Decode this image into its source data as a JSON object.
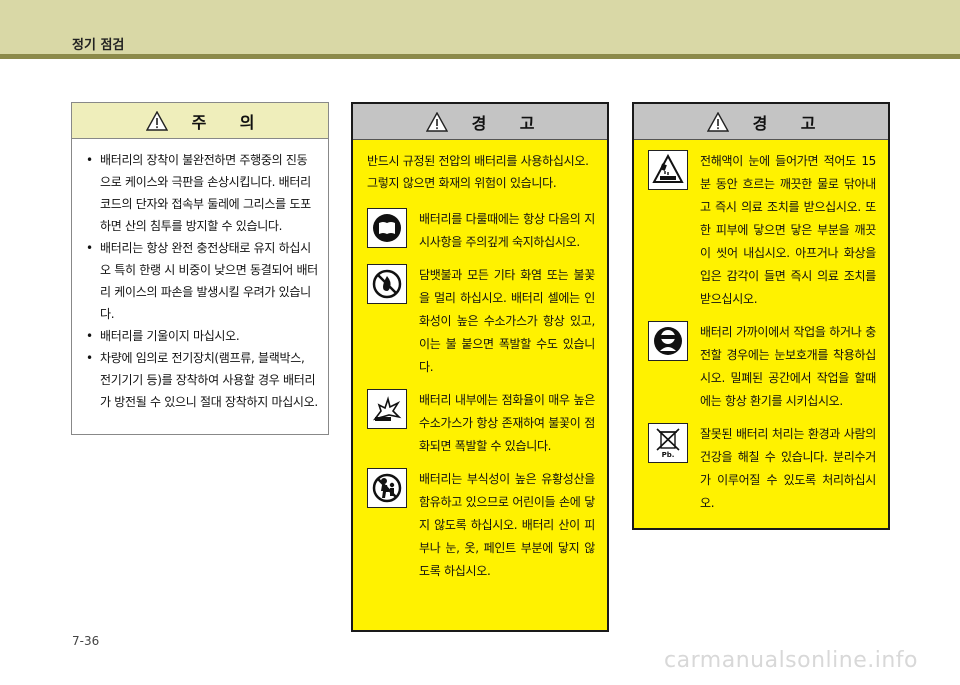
{
  "header": {
    "title": "정기 점검"
  },
  "caution": {
    "heading": "주      의",
    "items": [
      "배터리의 장착이 불완전하면 주행중의 진동으로 케이스와 극판을 손상시킵니다. 배터리 코드의 단자와 접속부 둘레에 그리스를 도포하면 산의 침투를 방지할 수 있습니다.",
      "배터리는 항상 완전 충전상태로 유지 하십시오 특히 한랭 시 비중이 낮으면 동결되어 배터리 케이스의 파손을 발생시킬 우려가 있습니다.",
      "배터리를 기울이지 마십시오.",
      "차량에 임의로 전기장치(램프류, 블랙박스, 전기기기 등)를 장착하여 사용할 경우 배터리가 방전될 수 있으니 절대 장착하지 마십시오."
    ]
  },
  "warning1": {
    "heading": "경      고",
    "intro": "반드시 규정된 전압의 배터리를 사용하십시오. 그렇지 않으면 화재의 위험이 있습니다.",
    "items": [
      {
        "icon": "book-icon",
        "text": "배터리를 다룰때에는 항상 다음의 지시사항을 주의깊게 숙지하십시오."
      },
      {
        "icon": "no-fire-icon",
        "text": "담뱃불과 모든 기타 화염 또는 불꽃을 멀리 하십시오. 배터리 셀에는 인화성이 높은 수소가스가 항상 있고, 이는 불 붙으면 폭발할 수도 있습니다."
      },
      {
        "icon": "explosion-icon",
        "text": "배터리 내부에는 점화율이 매우 높은 수소가스가 항상 존재하여 불꽃이 점화되면 폭발할 수 있습니다."
      },
      {
        "icon": "no-children-icon",
        "text": "배터리는 부식성이 높은 유황성산을 함유하고 있으므로 어린이들 손에 닿지 않도록 하십시오. 배터리 산이 피부나 눈, 옷, 페인트 부분에 닿지 않도록 하십시오."
      }
    ]
  },
  "warning2": {
    "heading": "경      고",
    "items": [
      {
        "icon": "acid-burn-icon",
        "text": "전해액이 눈에 들어가면 적어도 15분 동안 흐르는 깨끗한 물로 닦아내고 즉시 의료 조치를 받으십시오. 또한 피부에 닿으면 닿은 부분을 깨끗이 씻어 내십시오. 아프거나 화상을 입은 감각이 들면 즉시 의료 조치를 받으십시오."
      },
      {
        "icon": "eye-protection-icon",
        "text": "배터리 가까이에서 작업을 하거나 충전할 경우에는 눈보호개를 착용하십시오. 밀폐된 공간에서 작업을 할때에는 항상 환기를 시키십시오."
      },
      {
        "icon": "recycle-bin-icon",
        "text": "잘못된 배터리 처리는 환경과 사람의 건강을 해칠 수 있습니다. 분리수거가 이루어질 수 있도록 처리하십시오.",
        "label": "Pb."
      }
    ]
  },
  "page": {
    "number": "7-36"
  },
  "watermark": "carmanualsonline.info"
}
